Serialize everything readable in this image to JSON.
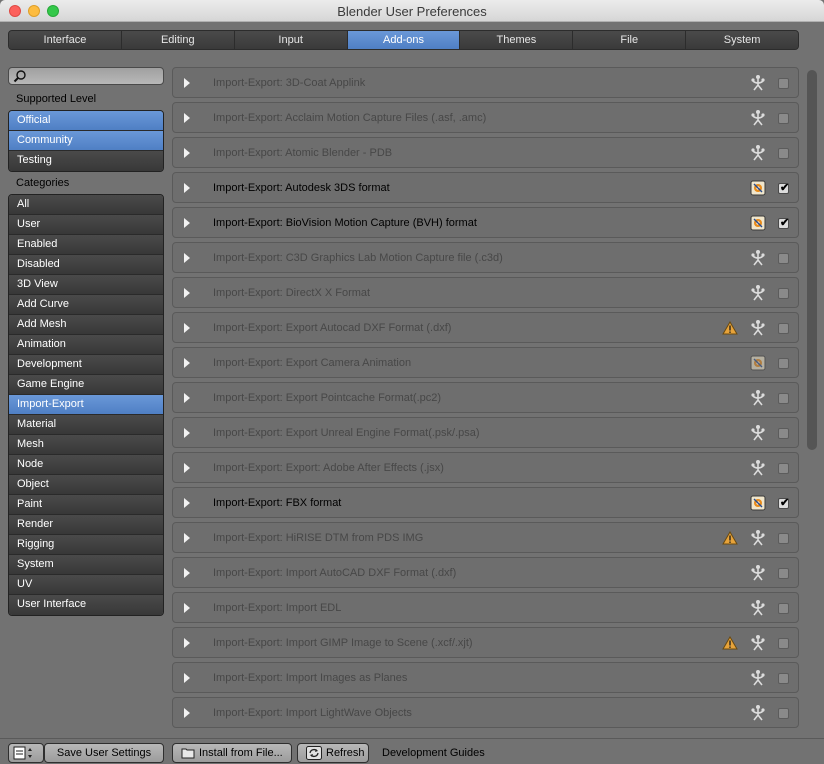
{
  "window": {
    "title": "Blender User Preferences"
  },
  "tabs": [
    {
      "label": "Interface"
    },
    {
      "label": "Editing"
    },
    {
      "label": "Input"
    },
    {
      "label": "Add-ons",
      "active": true
    },
    {
      "label": "Themes"
    },
    {
      "label": "File"
    },
    {
      "label": "System"
    }
  ],
  "sidebar": {
    "supported_level_label": "Supported Level",
    "supported_levels": [
      {
        "label": "Official",
        "selected": true
      },
      {
        "label": "Community",
        "selected": true
      },
      {
        "label": "Testing",
        "selected": false
      }
    ],
    "categories_label": "Categories",
    "categories": [
      {
        "label": "All"
      },
      {
        "label": "User"
      },
      {
        "label": "Enabled"
      },
      {
        "label": "Disabled"
      },
      {
        "label": "3D View"
      },
      {
        "label": "Add Curve"
      },
      {
        "label": "Add Mesh"
      },
      {
        "label": "Animation"
      },
      {
        "label": "Development"
      },
      {
        "label": "Game Engine"
      },
      {
        "label": "Import-Export",
        "selected": true
      },
      {
        "label": "Material"
      },
      {
        "label": "Mesh"
      },
      {
        "label": "Node"
      },
      {
        "label": "Object"
      },
      {
        "label": "Paint"
      },
      {
        "label": "Render"
      },
      {
        "label": "Rigging"
      },
      {
        "label": "System"
      },
      {
        "label": "UV"
      },
      {
        "label": "User Interface"
      }
    ]
  },
  "addons": [
    {
      "label": "Import-Export: 3D-Coat Applink",
      "enabled": false,
      "warning": false,
      "support": "community"
    },
    {
      "label": "Import-Export: Acclaim Motion Capture Files (.asf, .amc)",
      "enabled": false,
      "warning": false,
      "support": "community"
    },
    {
      "label": "Import-Export: Atomic Blender - PDB",
      "enabled": false,
      "warning": false,
      "support": "community"
    },
    {
      "label": "Import-Export: Autodesk 3DS format",
      "enabled": true,
      "warning": false,
      "support": "official"
    },
    {
      "label": "Import-Export: BioVision Motion Capture (BVH) format",
      "enabled": true,
      "warning": false,
      "support": "official"
    },
    {
      "label": "Import-Export: C3D Graphics Lab Motion Capture file (.c3d)",
      "enabled": false,
      "warning": false,
      "support": "community"
    },
    {
      "label": "Import-Export: DirectX X Format",
      "enabled": false,
      "warning": false,
      "support": "community"
    },
    {
      "label": "Import-Export: Export Autocad DXF Format (.dxf)",
      "enabled": false,
      "warning": true,
      "support": "community"
    },
    {
      "label": "Import-Export: Export Camera Animation",
      "enabled": false,
      "warning": false,
      "support": "official"
    },
    {
      "label": "Import-Export: Export Pointcache Format(.pc2)",
      "enabled": false,
      "warning": false,
      "support": "community"
    },
    {
      "label": "Import-Export: Export Unreal Engine Format(.psk/.psa)",
      "enabled": false,
      "warning": false,
      "support": "community"
    },
    {
      "label": "Import-Export: Export: Adobe After Effects (.jsx)",
      "enabled": false,
      "warning": false,
      "support": "community"
    },
    {
      "label": "Import-Export: FBX format",
      "enabled": true,
      "warning": false,
      "support": "official"
    },
    {
      "label": "Import-Export: HiRISE DTM from PDS IMG",
      "enabled": false,
      "warning": true,
      "support": "community"
    },
    {
      "label": "Import-Export: Import AutoCAD DXF Format (.dxf)",
      "enabled": false,
      "warning": false,
      "support": "community"
    },
    {
      "label": "Import-Export: Import EDL",
      "enabled": false,
      "warning": false,
      "support": "community"
    },
    {
      "label": "Import-Export: Import GIMP Image to Scene (.xcf/.xjt)",
      "enabled": false,
      "warning": true,
      "support": "community"
    },
    {
      "label": "Import-Export: Import Images as Planes",
      "enabled": false,
      "warning": false,
      "support": "community"
    },
    {
      "label": "Import-Export: Import LightWave Objects",
      "enabled": false,
      "warning": false,
      "support": "community"
    }
  ],
  "bottom": {
    "save_label": "Save User Settings",
    "install_label": "Install from File...",
    "refresh_label": "Refresh",
    "dev_guides_label": "Development Guides"
  },
  "colors": {
    "accent": "#5b8bd0",
    "panel": "#727272",
    "row": "#6e6e6e"
  }
}
